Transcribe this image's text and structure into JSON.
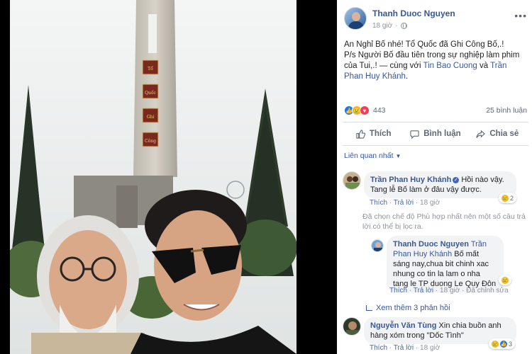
{
  "post": {
    "author": "Thanh Duoc Nguyen",
    "time": "18 giờ",
    "caption_line1": "An Nghỉ Bố nhé! Tổ Quốc đã Ghi Công Bố,.!",
    "caption_line2": "P/s Người Bố đầu tiên trong sự nghiệp làm phim của Tui,.! — cùng với ",
    "tag1": "Tin Bao Cuong",
    "tag_joiner": " và ",
    "tag2": "Trần Phan Huy Khánh",
    "tag_end": ".",
    "reaction_count": "443",
    "comment_count": "25 bình luận"
  },
  "actions": {
    "like": "Thích",
    "comment": "Bình luận",
    "share": "Chia sẻ"
  },
  "sort_label": "Liên quan nhất",
  "monument_chars": [
    "Tổ",
    "Quốc",
    "Ghi",
    "Công"
  ],
  "comments": [
    {
      "name": "Trần Phan Huy Khánh",
      "text": "Hồi nào vậy. Tang lễ Bố làm ở đâu vậy được.",
      "reacts": "2",
      "like": "Thích",
      "reply": "Trả lời",
      "time": "18 giờ"
    }
  ],
  "filter_note": "Đã chọn chế độ Phù hợp nhất nên một số câu trả lời có thể bị lọc ra.",
  "reply": {
    "name": "Thanh Duoc Nguyen",
    "tag": "Trần Phan Huy Khánh",
    "text": " Bố mất sáng nay,chua bit chinh xac nhung co tin la lam o nha tang le TP duong Le Quy Đôn",
    "like": "Thích",
    "reply_label": "Trả lời",
    "time": "18 giờ",
    "edited": "Đã chỉnh sửa"
  },
  "more_replies": "Xem thêm 3 phản hồi",
  "comment2": {
    "name": "Nguyễn Văn Tùng",
    "text": " Xin chia buồn anh hàng xóm trong \"Dốc Tình\"",
    "reacts": "3",
    "like": "Thích",
    "reply": "Trả lời",
    "time": "18 giờ"
  }
}
